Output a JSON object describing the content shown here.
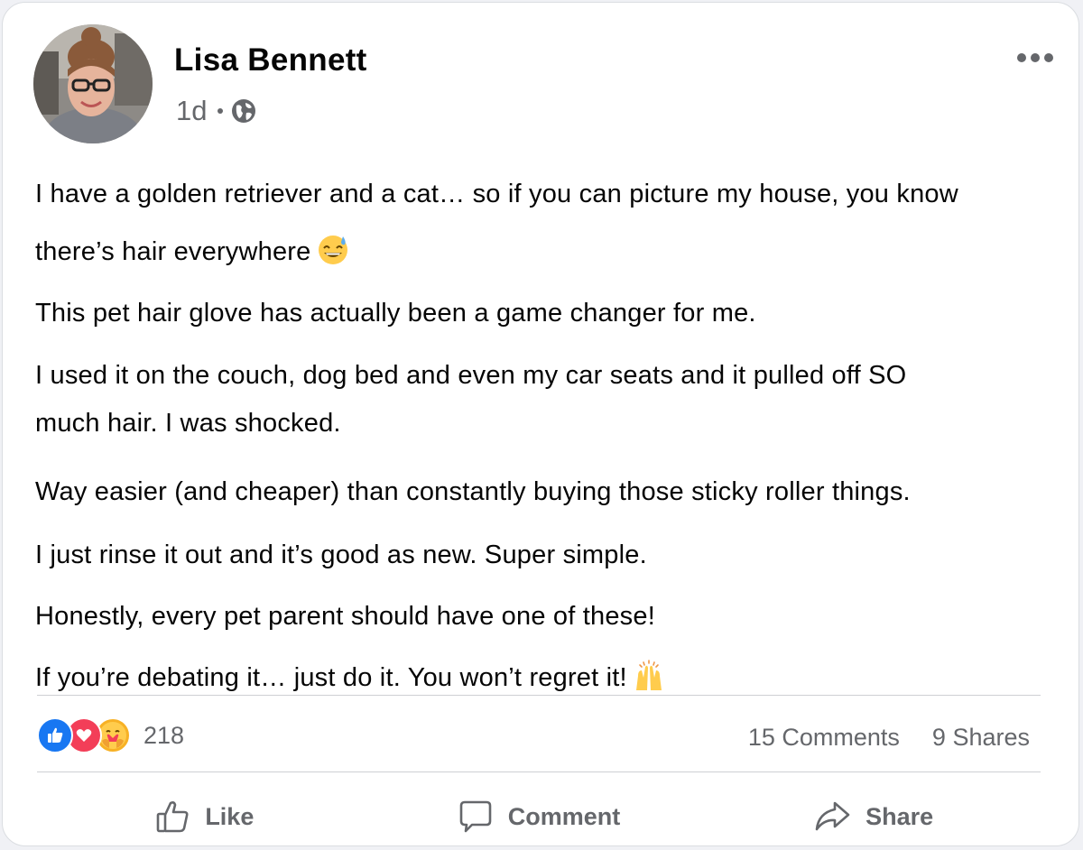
{
  "post": {
    "author": "Lisa Bennett",
    "time": "1d",
    "audience_icon": "globe-icon",
    "paragraphs": [
      "I have a golden retriever and a cat… so if you can picture my house, you know",
      "there’s hair everywhere",
      "This pet hair glove has actually been a game changer for me.",
      "I used it on the couch, dog bed and even my car seats and it pulled off SO",
      "much hair. I was shocked.",
      "Way easier (and cheaper) than constantly buying those sticky roller things.",
      "I just rinse it out and it’s good as new. Super simple.",
      "Honestly, every pet parent should have one of these!",
      "If you’re debating it… just do it. You won’t regret it!"
    ],
    "emojis": [
      "grinning-sweat-emoji",
      "raising-hands-emoji"
    ]
  },
  "engagement": {
    "reaction_icons": [
      "like-reaction-icon",
      "love-reaction-icon",
      "care-reaction-icon"
    ],
    "reaction_count": "218",
    "comments": "15 Comments",
    "shares": "9 Shares"
  },
  "actions": {
    "like": "Like",
    "comment": "Comment",
    "share": "Share"
  },
  "colors": {
    "like_blue": "#1877f2",
    "love_red": "#f33e58",
    "care_yellow": "#f7b125",
    "secondary_text": "#65676b",
    "primary_text": "#050505"
  }
}
